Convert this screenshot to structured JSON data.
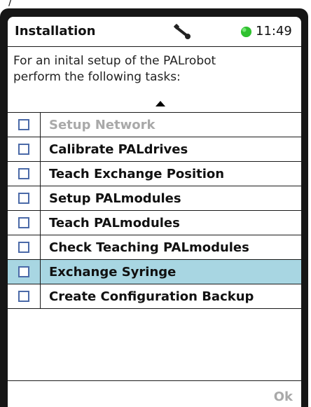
{
  "header": {
    "title": "Installation",
    "time": "11:49",
    "status_color": "#2fc12f",
    "tool_icon": "wrench-icon"
  },
  "intro": {
    "line1": "For an inital setup of the PALrobot",
    "line2": "perform the following tasks:"
  },
  "tasks": [
    {
      "label": "Setup Network",
      "checked": false,
      "enabled": false,
      "selected": false
    },
    {
      "label": "Calibrate PALdrives",
      "checked": false,
      "enabled": true,
      "selected": false
    },
    {
      "label": "Teach Exchange Position",
      "checked": false,
      "enabled": true,
      "selected": false
    },
    {
      "label": "Setup PALmodules",
      "checked": false,
      "enabled": true,
      "selected": false
    },
    {
      "label": "Teach PALmodules",
      "checked": false,
      "enabled": true,
      "selected": false
    },
    {
      "label": "Check Teaching PALmodules",
      "checked": false,
      "enabled": true,
      "selected": false
    },
    {
      "label": "Exchange Syringe",
      "checked": false,
      "enabled": true,
      "selected": true
    },
    {
      "label": "Create Configuration Backup",
      "checked": false,
      "enabled": true,
      "selected": false
    }
  ],
  "footer": {
    "ok_label": "Ok",
    "ok_enabled": false
  },
  "colors": {
    "selected_row": "#a8d6e2",
    "checkbox_border": "#4b6aa8",
    "disabled_text": "#a9a9a9",
    "device_frame": "#161616"
  }
}
